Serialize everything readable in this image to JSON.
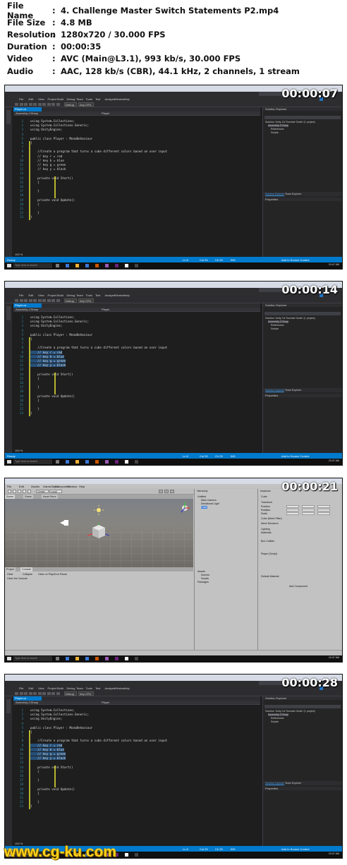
{
  "info": [
    {
      "key": "File Name",
      "sep": ":",
      "val": "4. Challenge Master Switch Statements P2.mp4"
    },
    {
      "key": "File Size",
      "sep": ":",
      "val": "4.8 MB"
    },
    {
      "key": "Resolution",
      "sep": ":",
      "val": "1280x720 / 30.000 FPS"
    },
    {
      "key": "Duration",
      "sep": ":",
      "val": "00:00:35"
    },
    {
      "key": "Video",
      "sep": ":",
      "val": "AVC (Main@L3.1), 993 kb/s, 30.000 FPS"
    },
    {
      "key": "Audio",
      "sep": ":",
      "val": "AAC, 128 kb/s (CBR), 44.1 kHz, 2 channels, 1 stream"
    }
  ],
  "frames": [
    {
      "timecode": "00:00:07"
    },
    {
      "timecode": "00:00:14"
    },
    {
      "timecode": "00:00:21"
    },
    {
      "timecode": "00:00:28"
    }
  ],
  "vs": {
    "menu": [
      "File",
      "Edit",
      "View",
      "Project",
      "Build",
      "Debug",
      "Team",
      "Tools",
      "Test",
      "Analyze",
      "Window",
      "Help"
    ],
    "config": "Debug",
    "platform": "Any CPU",
    "tab": "Player.cs",
    "nav_left": "Assembly-CSharp",
    "nav_mid": "Player",
    "solution_explorer": "Solution Explorer",
    "solution_items": [
      "Solution 'Unity C# Survival Guide' (1 project)",
      "Assembly-CSharp",
      "References",
      "Scripts"
    ],
    "properties": "Properties",
    "panel_tabs": [
      "Solution Explorer",
      "Team Explorer"
    ],
    "zoom": "100 %",
    "status_ready": "Ready",
    "status_right": "Add to Source Control",
    "status_ln": "Ln 8",
    "status_col": "Col 25",
    "status_ch": "Ch 25",
    "status_ins": "INS",
    "code_lines": [
      "using System.Collections;",
      "using System.Collections.Generic;",
      "using UnityEngine;",
      "",
      "public class Player : MonoBehaviour",
      "{",
      "",
      "    //Create a program that turns a cube different colors based on user input",
      "    // key r = red",
      "    // key b = blue",
      "    // key g = green",
      "    // key y = black",
      "",
      "    private void Start()",
      "    {",
      "",
      "    }",
      "",
      "    private void Update()",
      "    {",
      "",
      "    }",
      "}"
    ]
  },
  "taskbar": {
    "search": "Type here to search",
    "time": "10:47 AM",
    "date": "2/28/2018"
  },
  "unity": {
    "menu": [
      "File",
      "Edit",
      "Assets",
      "GameObject",
      "Component",
      "Window",
      "Help"
    ],
    "pivot": "Center",
    "space": "Local",
    "layers": "Layers",
    "layout": "Layout",
    "tabs_scene": [
      "Scene",
      "Game",
      "Asset Store"
    ],
    "hierarchy_title": "Hierarchy",
    "hierarchy_items": [
      "Untitled",
      "Main Camera",
      "Directional Light",
      "Cube"
    ],
    "inspector_title": "Inspector",
    "inspector_items": [
      "Cube",
      "Transform",
      "Position",
      "Rotation",
      "Scale",
      "Cube (Mesh Filter)",
      "Mesh Renderer",
      "Lighting",
      "Materials",
      "Box Collider",
      "Player (Script)",
      "Default-Material",
      "Add Component"
    ],
    "console_tabs": [
      "Project",
      "Console"
    ],
    "console_buttons": [
      "Clear",
      "Collapse",
      "Clear on Play",
      "Error Pause"
    ],
    "console_msg": "Clear the Console",
    "project_items": [
      "Assets",
      "Scenes",
      "Scripts",
      "Packages"
    ]
  },
  "watermark": "www.cg-ku.com"
}
